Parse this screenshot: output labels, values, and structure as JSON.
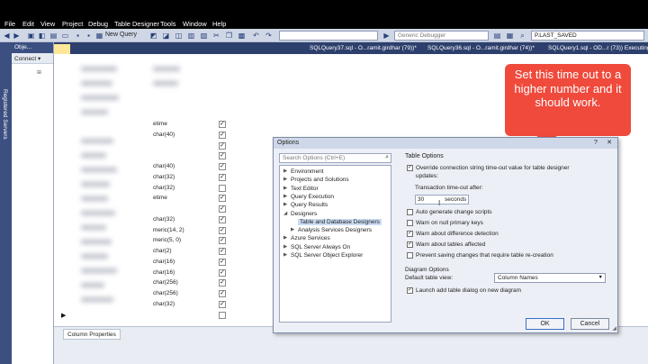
{
  "menu": [
    "File",
    "Edit",
    "View",
    "Project",
    "Debug",
    "Table Designer",
    "Tools",
    "Window",
    "Help"
  ],
  "toolbar": {
    "new_query_label": "New Query",
    "debugger_label": "Generic Debugger",
    "search_value": "P.LAST_SAVED"
  },
  "sidebar": {
    "vertical_label": "Registered Servers"
  },
  "object_explorer": {
    "title": "Obje...",
    "connect_label": "Connect ▾"
  },
  "doc_tabs": [
    "SQLQuery37.sql - O...ramit.girdhar (79))*",
    "SQLQuery36.sql - O...ramit.girdhar (74))*",
    "SQLQuery1.sql - OD...r (73)) Executing..."
  ],
  "designer_rows": [
    {
      "type": "etime",
      "checked": true
    },
    {
      "type": "char(40)",
      "checked": true
    },
    {
      "type": "",
      "checked": true
    },
    {
      "type": "",
      "checked": true
    },
    {
      "type": "char(40)",
      "checked": true
    },
    {
      "type": "char(32)",
      "checked": true
    },
    {
      "type": "char(32)",
      "checked": false
    },
    {
      "type": "etime",
      "checked": true
    },
    {
      "type": "",
      "checked": true
    },
    {
      "type": "char(32)",
      "checked": true
    },
    {
      "type": "meric(14, 2)",
      "checked": true
    },
    {
      "type": "meric(5, 0)",
      "checked": true
    },
    {
      "type": "char(2)",
      "checked": true
    },
    {
      "type": "char(16)",
      "checked": true
    },
    {
      "type": "char(16)",
      "checked": true
    },
    {
      "type": "char(256)",
      "checked": true
    },
    {
      "type": "char(256)",
      "checked": true
    },
    {
      "type": "char(32)",
      "checked": true
    },
    {
      "type": "",
      "checked": false
    }
  ],
  "column_properties_tab": "Column Properties",
  "callout_text": "Set this time out to a higher number and it should work.",
  "dialog": {
    "title": "Options",
    "search_placeholder": "Search Options (Ctrl+E)",
    "tree": [
      {
        "label": "Environment",
        "arrow": "▶",
        "indent": 0
      },
      {
        "label": "Projects and Solutions",
        "arrow": "▶",
        "indent": 0
      },
      {
        "label": "Text Editor",
        "arrow": "▶",
        "indent": 0
      },
      {
        "label": "Query Execution",
        "arrow": "▶",
        "indent": 0
      },
      {
        "label": "Query Results",
        "arrow": "▶",
        "indent": 0
      },
      {
        "label": "Designers",
        "arrow": "◢",
        "indent": 0
      },
      {
        "label": "Table and Database Designers",
        "arrow": "",
        "indent": 1,
        "selected": true
      },
      {
        "label": "Analysis Services Designers",
        "arrow": "▶",
        "indent": 1
      },
      {
        "label": "Azure Services",
        "arrow": "▶",
        "indent": 0
      },
      {
        "label": "SQL Server Always On",
        "arrow": "▶",
        "indent": 0
      },
      {
        "label": "SQL Server Object Explorer",
        "arrow": "▶",
        "indent": 0
      }
    ],
    "table_options_heading": "Table Options",
    "override_label": "Override connection string time-out value for table designer",
    "override_label_2": "updates:",
    "override_checked": true,
    "timeout_label": "Transaction time-out after:",
    "timeout_value": "30",
    "timeout_unit": "seconds",
    "options": [
      {
        "label": "Auto generate change scripts",
        "checked": false
      },
      {
        "label": "Warn on null primary keys",
        "checked": false
      },
      {
        "label": "Warn about difference detection",
        "checked": true
      },
      {
        "label": "Warn about tables affected",
        "checked": true
      },
      {
        "label": "Prevent saving changes that require table re-creation",
        "checked": false
      }
    ],
    "diagram_heading": "Diagram Options",
    "default_view_label": "Default table view:",
    "default_view_value": "Column Names",
    "launch_label": "Launch add table dialog on new diagram",
    "launch_checked": true,
    "ok_label": "OK",
    "cancel_label": "Cancel"
  },
  "colors": {
    "callout": "#ef4a3c",
    "chrome_blue": "#3b4f81",
    "active_tab": "#ffe79a"
  }
}
